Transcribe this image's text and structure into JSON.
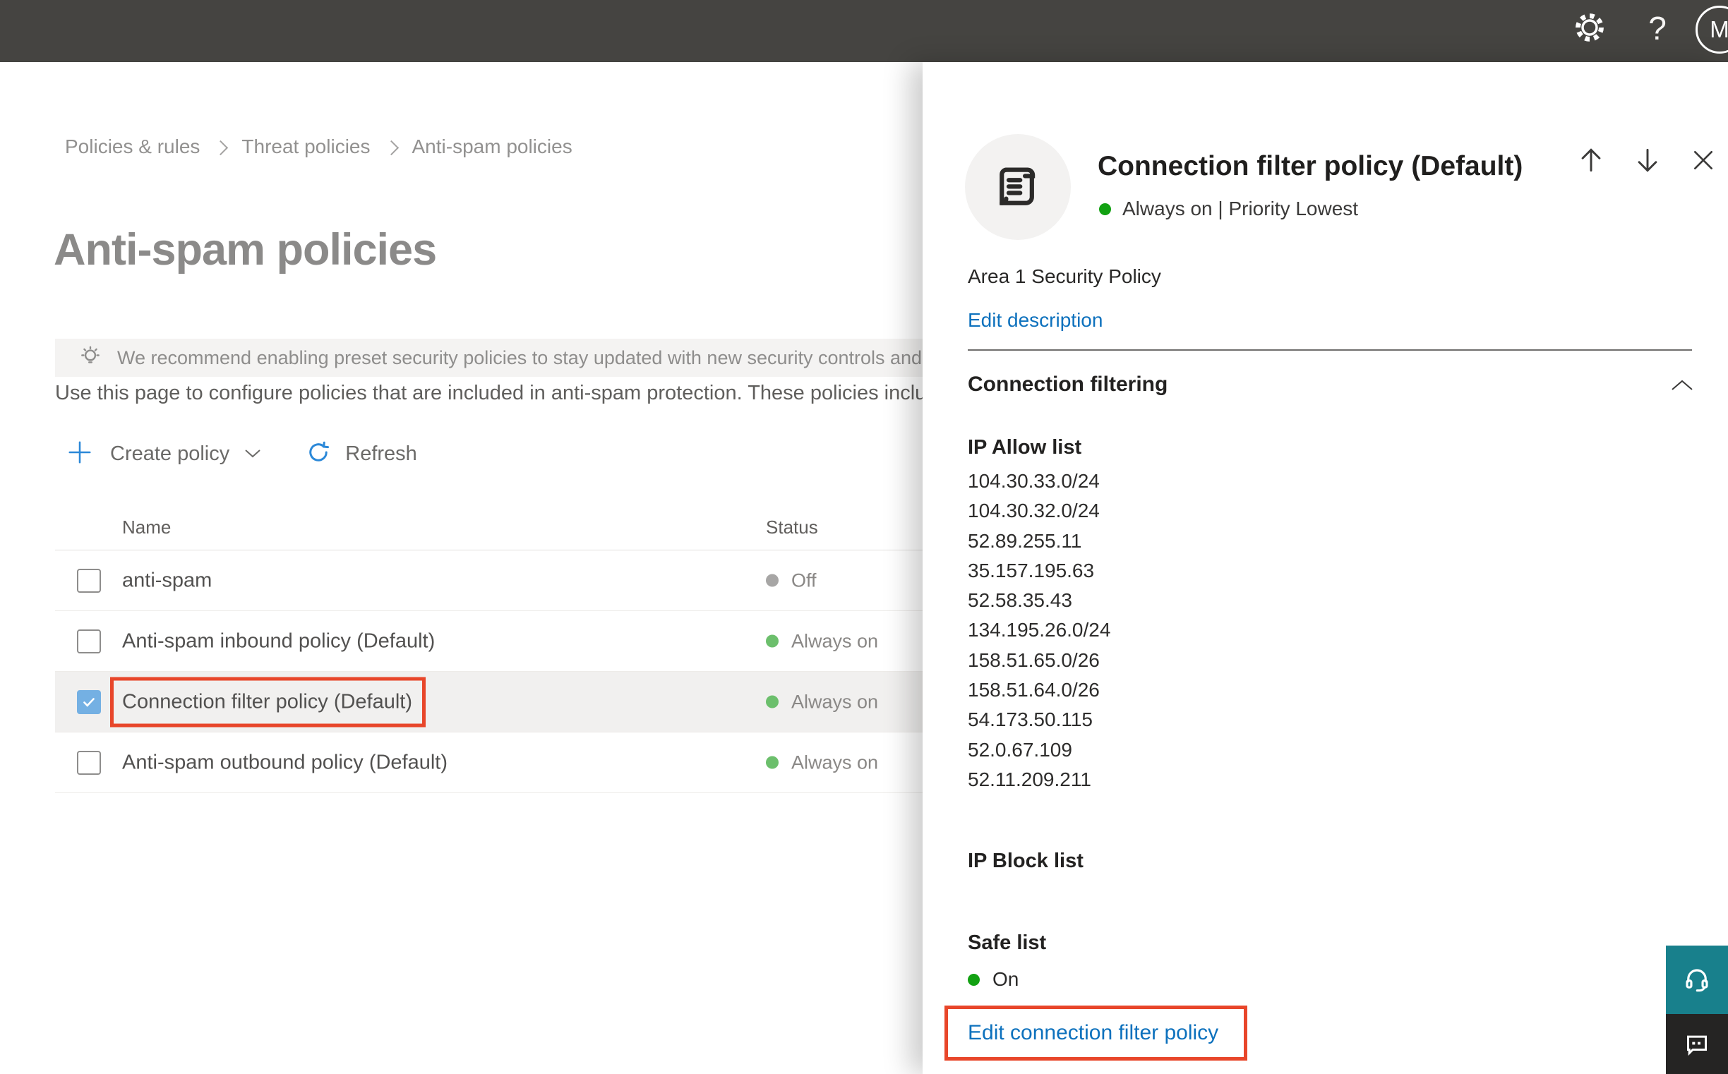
{
  "topbar": {
    "help_label": "?",
    "avatar_initial": "M"
  },
  "breadcrumb": {
    "items": [
      "Policies & rules",
      "Threat policies",
      "Anti-spam policies"
    ]
  },
  "page": {
    "title": "Anti-spam policies",
    "banner_text": "We recommend enabling preset security policies to stay updated with new security controls and our recommendations.",
    "description": "Use this page to configure policies that are included in anti-spam protection. These policies include"
  },
  "toolbar": {
    "create_label": "Create policy",
    "refresh_label": "Refresh"
  },
  "table": {
    "columns": {
      "name": "Name",
      "status": "Status"
    },
    "rows": [
      {
        "name": "anti-spam",
        "status": "Off",
        "checked": false
      },
      {
        "name": "Anti-spam inbound policy (Default)",
        "status": "Always on",
        "checked": false
      },
      {
        "name": "Connection filter policy (Default)",
        "status": "Always on",
        "checked": true
      },
      {
        "name": "Anti-spam outbound policy (Default)",
        "status": "Always on",
        "checked": false
      }
    ]
  },
  "panel": {
    "title": "Connection filter policy (Default)",
    "status_line": "Always on | Priority Lowest",
    "description": "Area 1 Security Policy",
    "edit_description_label": "Edit description",
    "section_title": "Connection filtering",
    "ip_allow": {
      "label": "IP Allow list",
      "items": [
        "104.30.33.0/24",
        "104.30.32.0/24",
        "52.89.255.11",
        "35.157.195.63",
        "52.58.35.43",
        "134.195.26.0/24",
        "158.51.65.0/26",
        "158.51.64.0/26",
        "54.173.50.115",
        "52.0.67.109",
        "52.11.209.211"
      ]
    },
    "ip_block": {
      "label": "IP Block list"
    },
    "safe_list": {
      "label": "Safe list",
      "value": "On"
    },
    "edit_link_label": "Edit connection filter policy"
  },
  "icons": {
    "settings": "gear-icon",
    "help": "question-mark-icon",
    "lightbulb": "lightbulb-icon",
    "add": "plus-icon",
    "refresh": "refresh-icon",
    "policy": "scroll-icon",
    "up": "arrow-up-icon",
    "down": "arrow-down-icon",
    "close": "close-icon",
    "collapse": "chevron-up-icon",
    "support": "headset-icon",
    "feedback": "chat-icon"
  },
  "colors": {
    "accent_blue": "#0d71bd",
    "checkbox_blue": "#74b0e3",
    "highlight_red": "#e8462a",
    "status_green_table": "#6cbf6c",
    "status_green_panel": "#12a112",
    "status_gray": "#a7a6a5",
    "topbar_bg": "#454441",
    "banner_bg": "#f4f3f2",
    "support_teal": "#18808c"
  }
}
